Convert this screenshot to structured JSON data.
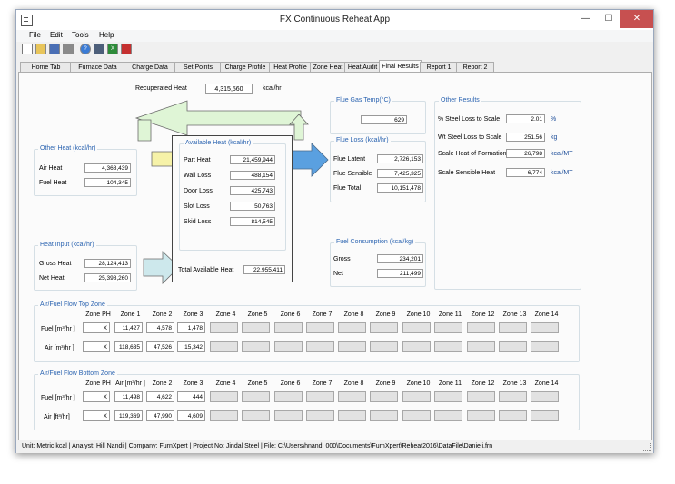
{
  "window": {
    "title": "FX Continuous Reheat App",
    "minimize": "—",
    "maximize": "☐",
    "close": "✕"
  },
  "menu": [
    "File",
    "Edit",
    "Tools",
    "Help"
  ],
  "toolbar": [
    "new-icon",
    "open-icon",
    "save-icon",
    "print-icon",
    "help-icon",
    "calculator-icon",
    "excel-icon",
    "pdf-icon"
  ],
  "tabs": [
    "Home Tab",
    "Furnace Data",
    "Charge Data",
    "Set Points",
    "Charge Profile",
    "Heat Profile",
    "Zone Heat",
    "Heat Audit",
    "Final Results",
    "Report 1",
    "Report 2"
  ],
  "active_tab": "Final Results",
  "recuperated": {
    "label": "Recuperated Heat",
    "value": "4,315,560",
    "unit": "kcal/hr"
  },
  "other_heat": {
    "title": "Other Heat  (kcal/hr)",
    "air_label": "Air Heat",
    "air": "4,368,439",
    "fuel_label": "Fuel Heat",
    "fuel": "104,345"
  },
  "heat_input": {
    "title": "Heat Input  (kcal/hr)",
    "gross_label": "Gross Heat",
    "gross": "28,124,413",
    "net_label": "Net Heat",
    "net": "25,398,260"
  },
  "available": {
    "title": "Available Heat  (kcal/hr)",
    "rows": [
      {
        "label": "Part Heat",
        "value": "21,459,944"
      },
      {
        "label": "Wall Loss",
        "value": "488,154"
      },
      {
        "label": "Door Loss",
        "value": "425,743"
      },
      {
        "label": "Slot Loss",
        "value": "50,763"
      },
      {
        "label": "Skid Loss",
        "value": "814,545"
      }
    ],
    "total_label": "Total Available Heat",
    "total": "22,955,411"
  },
  "flue_temp": {
    "title": "Flue Gas Temp(°C)",
    "value": "629"
  },
  "flue_loss": {
    "title": "Flue Loss  (kcal/hr)",
    "rows": [
      {
        "label": "Flue Latent",
        "value": "2,726,153"
      },
      {
        "label": "Flue Sensible",
        "value": "7,425,325"
      },
      {
        "label": "Flue Total",
        "value": "10,151,478"
      }
    ]
  },
  "fuel_consumption": {
    "title": "Fuel Consumption  (kcal/kg)",
    "gross_label": "Gross",
    "gross": "234,201",
    "net_label": "Net",
    "net": "211,499"
  },
  "other_results": {
    "title": "Other Results",
    "rows": [
      {
        "label": "% Steel Loss to Scale",
        "value": "2.01",
        "unit": "%"
      },
      {
        "label": "Wt Steel Loss to Scale",
        "value": "251.56",
        "unit": "kg"
      },
      {
        "label": "Scale Heat of Formation",
        "value": "26,798",
        "unit": "kcal/MT"
      },
      {
        "label": "Scale Sensible Heat",
        "value": "6,774",
        "unit": "kcal/MT"
      }
    ]
  },
  "top_zone": {
    "title": "Air/Fuel Flow Top Zone",
    "headers": [
      "Zone PH",
      "Zone 1",
      "Zone 2",
      "Zone 3",
      "Zone 4",
      "Zone 5",
      "Zone 6",
      "Zone 7",
      "Zone 8",
      "Zone 9",
      "Zone 10",
      "Zone 11",
      "Zone 12",
      "Zone 13",
      "Zone 14"
    ],
    "fuel_label": "Fuel [m³/hr ]",
    "fuel": [
      "X",
      "11,427",
      "4,578",
      "1,478"
    ],
    "air_label": "Air [m³/hr ]",
    "air": [
      "X",
      "118,635",
      "47,526",
      "15,342"
    ]
  },
  "bottom_zone": {
    "title": "Air/Fuel Flow Bottom Zone",
    "headers": [
      "Zone PH",
      "Air [m³/hr ]",
      "Zone 2",
      "Zone 3",
      "Zone 4",
      "Zone 5",
      "Zone 6",
      "Zone 7",
      "Zone 8",
      "Zone 9",
      "Zone 10",
      "Zone 11",
      "Zone 12",
      "Zone 13",
      "Zone 14"
    ],
    "fuel_label": "Fuel [m³/hr ]",
    "fuel": [
      "X",
      "11,498",
      "4,622",
      "444"
    ],
    "air_label": "Air [ft³/hr]",
    "air": [
      "X",
      "119,369",
      "47,990",
      "4,609"
    ]
  },
  "status": "Unit:  Metric kcal  | Analyst: Hill Nandi  | Company: FurnXpert  | Project No: Jindal Steel  | File: C:\\Users\\hnand_000\\Documents\\FurnXpert\\Reheat2016\\DataFile\\Danieli.frn",
  "colors": {
    "arrow_green": "#dff5d6",
    "arrow_yellow": "#f6f2a8",
    "arrow_blue": "#5aa0e0",
    "arrow_teal": "#cde8ec",
    "group_title": "#2a63b0"
  }
}
